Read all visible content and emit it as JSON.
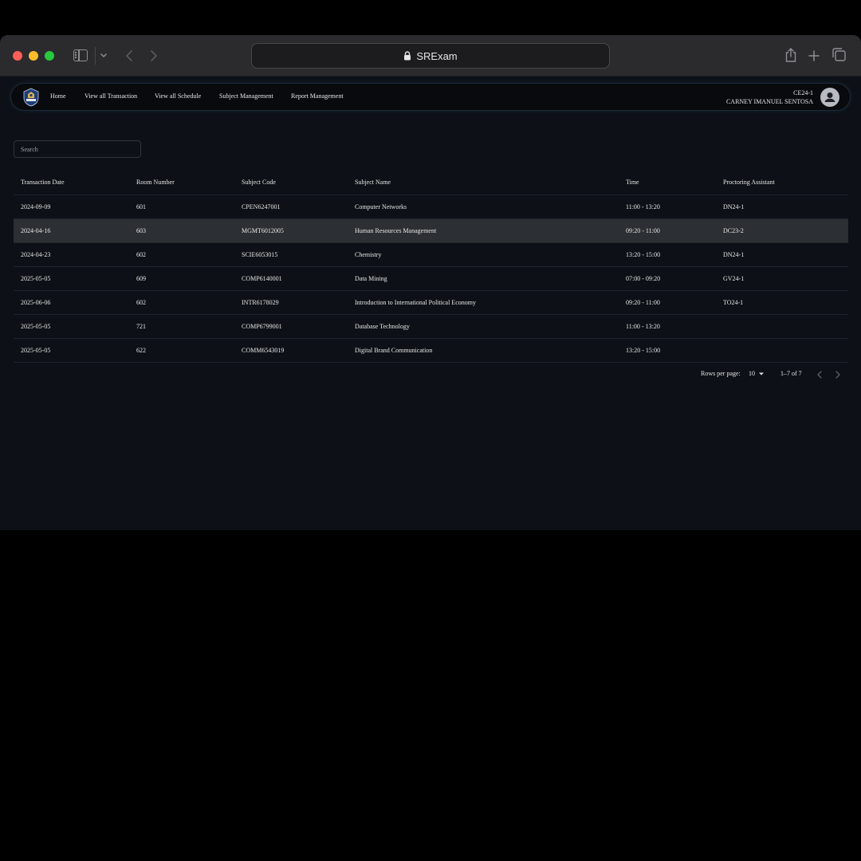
{
  "browser": {
    "url_display": "SRExam"
  },
  "nav": {
    "links": [
      "Home",
      "View all Transaction",
      "View all Schedule",
      "Subject Management",
      "Report Management"
    ],
    "user_code": "CE24-1",
    "user_name": "CARNEY IMANUEL SENTOSA"
  },
  "search": {
    "placeholder": "Search",
    "value": ""
  },
  "table": {
    "columns": [
      "Transaction Date",
      "Room Number",
      "Subject Code",
      "Subject Name",
      "Time",
      "Proctoring Assistant"
    ],
    "selected_row": 1,
    "rows": [
      [
        "2024-09-09",
        "601",
        "CPEN6247001",
        "Computer Networks",
        "11:00 - 13:20",
        "DN24-1"
      ],
      [
        "2024-04-16",
        "603",
        "MGMT6012005",
        "Human Resources Management",
        "09:20 - 11:00",
        "DC23-2"
      ],
      [
        "2024-04-23",
        "602",
        "SCIE6053015",
        "Chemistry",
        "13:20 - 15:00",
        "DN24-1"
      ],
      [
        "2025-05-05",
        "609",
        "COMP6140001",
        "Data Mining",
        "07:00 - 09:20",
        "GV24-1"
      ],
      [
        "2025-06-06",
        "602",
        "INTR6178029",
        "Introduction to International Political Economy",
        "09:20 - 11:00",
        "TO24-1"
      ],
      [
        "2025-05-05",
        "721",
        "COMP6799001",
        "Database Technology",
        "11:00 - 13:20",
        ""
      ],
      [
        "2025-05-05",
        "622",
        "COMM6543019",
        "Digital Brand Communication",
        "13:20 - 15:00",
        ""
      ]
    ]
  },
  "pagination": {
    "rows_per_page_label": "Rows per page:",
    "rows_per_page_value": "10",
    "range_text": "1–7 of 7"
  },
  "colors": {
    "page_bg": "#0d1117",
    "selected_row_bg": "#2c2f33",
    "traffic_red": "#ff5f57",
    "traffic_yellow": "#febc2e",
    "traffic_green": "#28c840"
  }
}
